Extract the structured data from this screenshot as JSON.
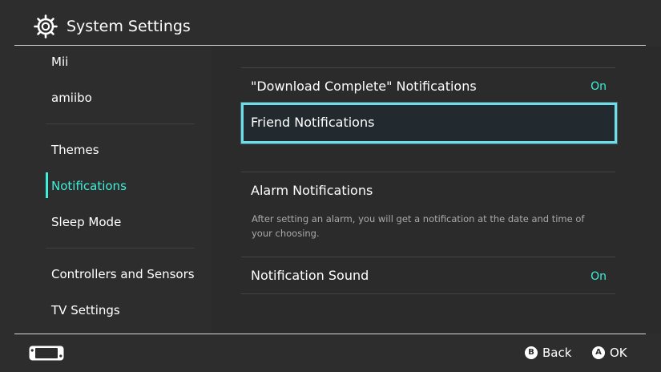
{
  "header": {
    "title": "System Settings",
    "icon": "gear-icon"
  },
  "sidebar": {
    "items": [
      {
        "label": "Mii",
        "active": false
      },
      {
        "label": "amiibo",
        "active": false
      },
      {
        "label": "Themes",
        "active": false
      },
      {
        "label": "Notifications",
        "active": true
      },
      {
        "label": "Sleep Mode",
        "active": false
      },
      {
        "label": "Controllers and Sensors",
        "active": false
      },
      {
        "label": "TV Settings",
        "active": false
      }
    ]
  },
  "content": {
    "rows": [
      {
        "label": "\"Download Complete\" Notifications",
        "value": "On"
      },
      {
        "label": "Friend Notifications",
        "focused": true
      },
      {
        "label": "Alarm Notifications",
        "description": "After setting an alarm, you will get a notification at the date and time of your choosing."
      },
      {
        "label": "Notification Sound",
        "value": "On"
      }
    ]
  },
  "footer": {
    "controller_icon": "handheld-console-icon",
    "back": {
      "button": "B",
      "label": "Back"
    },
    "ok": {
      "button": "A",
      "label": "OK"
    }
  },
  "colors": {
    "background": "#2d2d2d",
    "accent": "#3ef0d9",
    "focus_border": "#6fdde8",
    "text": "#ffffff",
    "description": "#a9a9a9"
  }
}
